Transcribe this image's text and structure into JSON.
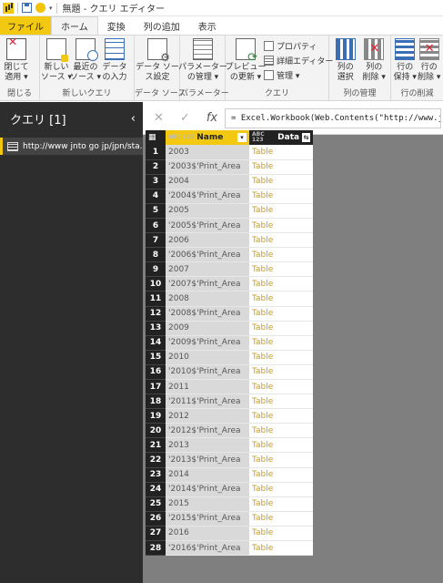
{
  "window": {
    "title": "無題 - クエリ エディター"
  },
  "tabs": [
    "ファイル",
    "ホーム",
    "変換",
    "列の追加",
    "表示"
  ],
  "ribbon": {
    "close": {
      "button": "閉じて\n適用 ▾",
      "group": "閉じる"
    },
    "new_query": {
      "new_source": "新しい\nソース ▾",
      "recent_source": "最近の\nソース ▾",
      "enter_data": "データ\nの入力",
      "group": "新しいクエリ"
    },
    "data_source": {
      "settings": "データ ソー\nス設定",
      "group": "データ ソース"
    },
    "parameters": {
      "manage": "パラメーター\nの管理 ▾",
      "group": "パラメーター"
    },
    "query": {
      "refresh": "プレビュー\nの更新 ▾",
      "properties": "プロパティ",
      "advanced_editor": "詳細エディター",
      "manage": "管理 ▾",
      "group": "クエリ"
    },
    "columns": {
      "choose": "列の\n選択",
      "remove": "列の\n削除 ▾",
      "group": "列の管理"
    },
    "rows": {
      "keep": "行の\n保持 ▾",
      "remove": "行の\n削除 ▾",
      "group": "行の削減"
    }
  },
  "queries_pane": {
    "title": "クエリ [1]",
    "items": [
      {
        "label": "http://www jnto go jp/jpn/sta..."
      }
    ]
  },
  "formula": {
    "text": "= Excel.Workbook(Web.Contents(\"http://www.jnto"
  },
  "grid": {
    "columns": [
      {
        "type": "ABC 123",
        "name": "Name"
      },
      {
        "type": "ABC 123",
        "name": "Data"
      }
    ],
    "rows": [
      {
        "n": "1",
        "name": "2003",
        "data": "Table"
      },
      {
        "n": "2",
        "name": "'2003$'Print_Area",
        "data": "Table"
      },
      {
        "n": "3",
        "name": "2004",
        "data": "Table"
      },
      {
        "n": "4",
        "name": "'2004$'Print_Area",
        "data": "Table"
      },
      {
        "n": "5",
        "name": "2005",
        "data": "Table"
      },
      {
        "n": "6",
        "name": "'2005$'Print_Area",
        "data": "Table"
      },
      {
        "n": "7",
        "name": "2006",
        "data": "Table"
      },
      {
        "n": "8",
        "name": "'2006$'Print_Area",
        "data": "Table"
      },
      {
        "n": "9",
        "name": "2007",
        "data": "Table"
      },
      {
        "n": "10",
        "name": "'2007$'Print_Area",
        "data": "Table"
      },
      {
        "n": "11",
        "name": "2008",
        "data": "Table"
      },
      {
        "n": "12",
        "name": "'2008$'Print_Area",
        "data": "Table"
      },
      {
        "n": "13",
        "name": "2009",
        "data": "Table"
      },
      {
        "n": "14",
        "name": "'2009$'Print_Area",
        "data": "Table"
      },
      {
        "n": "15",
        "name": "2010",
        "data": "Table"
      },
      {
        "n": "16",
        "name": "'2010$'Print_Area",
        "data": "Table"
      },
      {
        "n": "17",
        "name": "2011",
        "data": "Table"
      },
      {
        "n": "18",
        "name": "'2011$'Print_Area",
        "data": "Table"
      },
      {
        "n": "19",
        "name": "2012",
        "data": "Table"
      },
      {
        "n": "20",
        "name": "'2012$'Print_Area",
        "data": "Table"
      },
      {
        "n": "21",
        "name": "2013",
        "data": "Table"
      },
      {
        "n": "22",
        "name": "'2013$'Print_Area",
        "data": "Table"
      },
      {
        "n": "23",
        "name": "2014",
        "data": "Table"
      },
      {
        "n": "24",
        "name": "'2014$'Print_Area",
        "data": "Table"
      },
      {
        "n": "25",
        "name": "2015",
        "data": "Table"
      },
      {
        "n": "26",
        "name": "'2015$'Print_Area",
        "data": "Table"
      },
      {
        "n": "27",
        "name": "2016",
        "data": "Table"
      },
      {
        "n": "28",
        "name": "'2016$'Print_Area",
        "data": "Table"
      }
    ]
  },
  "colors": {
    "accent": "#f2c811",
    "pane": "#2d2d2d",
    "grid_bg": "#7f7f7f",
    "table_link": "#c79a1f"
  }
}
